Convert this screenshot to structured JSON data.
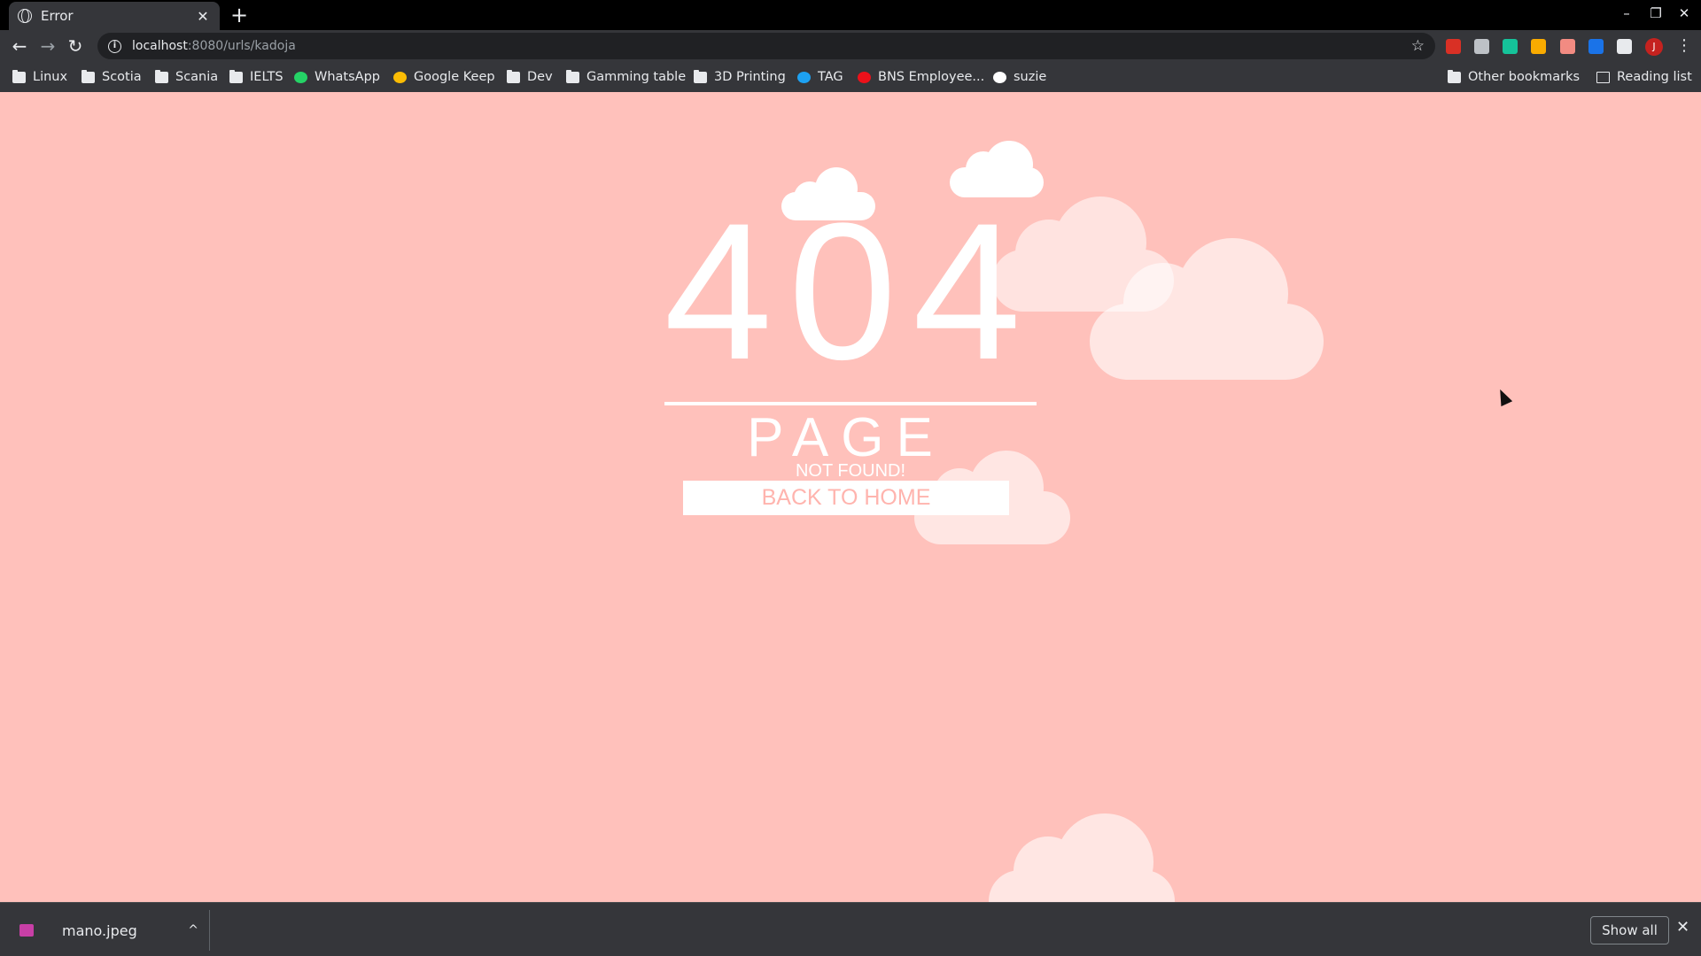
{
  "browser": {
    "tab": {
      "title": "Error",
      "close_glyph": "✕",
      "icon": "globe-icon"
    },
    "new_tab_glyph": "+",
    "window_controls": {
      "minimize": "–",
      "maximize": "❐",
      "close": "✕"
    },
    "nav": {
      "back": "←",
      "forward": "→",
      "reload": "↻"
    },
    "url": {
      "info_glyph": "i",
      "host": "localhost",
      "path": ":8080/urls/kadoja",
      "star": "☆"
    },
    "extensions": [
      {
        "name": "chart-extension-icon",
        "color": "#d93025"
      },
      {
        "name": "puzzle-piece-extension-icon",
        "color": "#bdc1c6"
      },
      {
        "name": "grammarly-extension-icon",
        "color": "#15c39a"
      },
      {
        "name": "pin-extension-icon",
        "color": "#f9ab00"
      },
      {
        "name": "branch-extension-icon",
        "color": "#f28b82"
      },
      {
        "name": "sync-extension-icon",
        "color": "#1a73e8"
      },
      {
        "name": "extensions-icon",
        "color": "#e8eaed"
      }
    ],
    "profile_initial": "J",
    "menu_glyph": "⋮"
  },
  "bookmarks": {
    "items": [
      {
        "label": "Linux",
        "type": "folder"
      },
      {
        "label": "Scotia",
        "type": "folder"
      },
      {
        "label": "Scania",
        "type": "folder"
      },
      {
        "label": "IELTS",
        "type": "folder"
      },
      {
        "label": "WhatsApp",
        "type": "site",
        "icon": "whatsapp-icon",
        "color": "#25d366"
      },
      {
        "label": "Google Keep",
        "type": "site",
        "icon": "google-keep-icon",
        "color": "#fbbc04"
      },
      {
        "label": "Dev",
        "type": "folder"
      },
      {
        "label": "Gamming table",
        "type": "folder"
      },
      {
        "label": "3D Printing",
        "type": "folder"
      },
      {
        "label": "TAG",
        "type": "site",
        "icon": "twitter-icon",
        "color": "#1da1f2"
      },
      {
        "label": "BNS Employee...",
        "type": "site",
        "icon": "scotiabank-icon",
        "color": "#ec111a"
      },
      {
        "label": "suzie",
        "type": "site",
        "icon": "amazon-icon",
        "color": "#ffffff"
      }
    ],
    "other": "Other bookmarks",
    "reading_list": "Reading list"
  },
  "page": {
    "background": "#ffc1bb",
    "code": "404",
    "page_word": "PAGE",
    "subtitle": "NOT FOUND!",
    "home_button": "BACK TO HOME"
  },
  "downloads": {
    "file": "mano.jpeg",
    "caret": "^",
    "show_all": "Show all",
    "close": "✕"
  }
}
